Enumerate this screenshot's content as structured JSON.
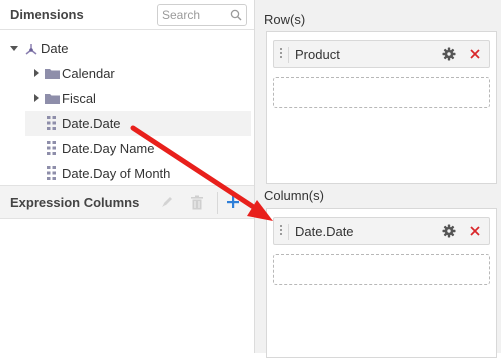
{
  "dimensions": {
    "title": "Dimensions",
    "search_placeholder": "Search"
  },
  "tree": {
    "root_label": "Date",
    "items": [
      {
        "label": "Calendar",
        "type": "folder"
      },
      {
        "label": "Fiscal",
        "type": "folder"
      },
      {
        "label": "Date.Date",
        "type": "field",
        "selected": true
      },
      {
        "label": "Date.Day Name",
        "type": "field"
      },
      {
        "label": "Date.Day of Month",
        "type": "field"
      }
    ]
  },
  "expression_columns": {
    "title": "Expression Columns"
  },
  "rows": {
    "title": "Row(s)",
    "items": [
      "Product"
    ]
  },
  "columns": {
    "title": "Column(s)",
    "items": [
      "Date.Date"
    ]
  },
  "colors": {
    "remove_x": "#d9262a",
    "add_plus": "#2f7fd8",
    "annotation_arrow": "#e8201c",
    "right_panel_bg": "#f1f1f1"
  }
}
